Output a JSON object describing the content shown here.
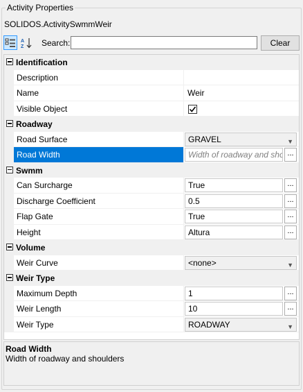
{
  "group_title": "Activity Properties",
  "object_name": "SOLIDOS.ActivitySwmmWeir",
  "toolbar": {
    "categorized_icon": "categorized-view-icon",
    "alphabetical_icon": "alphabetical-sort-icon",
    "search_label": "Search:",
    "search_value": "",
    "clear_label": "Clear"
  },
  "categories": {
    "identification": "Identification",
    "roadway": "Roadway",
    "swmm": "Swmm",
    "volume": "Volume",
    "weir_type": "Weir Type"
  },
  "props": {
    "description": {
      "label": "Description",
      "value": ""
    },
    "name": {
      "label": "Name",
      "value": "Weir"
    },
    "visible_object": {
      "label": "Visible Object",
      "checked": true
    },
    "road_surface": {
      "label": "Road Surface",
      "value": "GRAVEL"
    },
    "road_width": {
      "label": "Road Width",
      "placeholder": "Width of roadway and shoulders"
    },
    "can_surcharge": {
      "label": "Can Surcharge",
      "value": "True"
    },
    "discharge_coefficient": {
      "label": "Discharge Coefficient",
      "value": "0.5"
    },
    "flap_gate": {
      "label": "Flap Gate",
      "value": "True"
    },
    "height": {
      "label": "Height",
      "value": "Altura"
    },
    "weir_curve": {
      "label": "Weir Curve",
      "value": "<none>"
    },
    "maximum_depth": {
      "label": "Maximum Depth",
      "value": "1"
    },
    "weir_length": {
      "label": "Weir Length",
      "value": "10"
    },
    "weir_type": {
      "label": "Weir Type",
      "value": "ROADWAY"
    }
  },
  "ellipsis_label": "...",
  "description_panel": {
    "title": "Road Width",
    "text": "Width of roadway and shoulders"
  },
  "colors": {
    "selection": "#0078d7",
    "category_bg": "#f0f0f0"
  }
}
